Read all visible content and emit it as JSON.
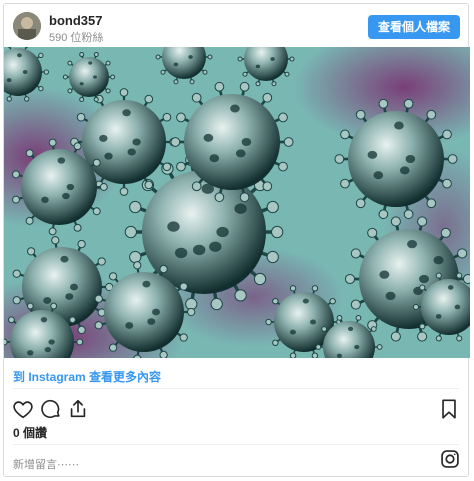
{
  "post": {
    "username": "bond357",
    "followers": "590 位粉絲",
    "profile_button": "查看個人檔案",
    "more_link": "到 Instagram 查看更多內容",
    "likes": "0 個讚",
    "add_comment_placeholder": "新增留言⋯⋯"
  },
  "icons": {
    "avatar": "avatar",
    "like": "heart-icon",
    "comment": "comment-bubble-icon",
    "share": "share-icon",
    "save": "bookmark-icon",
    "instagram": "instagram-logo-icon"
  },
  "colors": {
    "accent": "#3897f0",
    "text": "#262626",
    "muted": "#8e8e8e",
    "photo_background": "#7ab4b2",
    "photo_purple": "#6a3f6e",
    "virus_body": "#1e4a4a"
  }
}
